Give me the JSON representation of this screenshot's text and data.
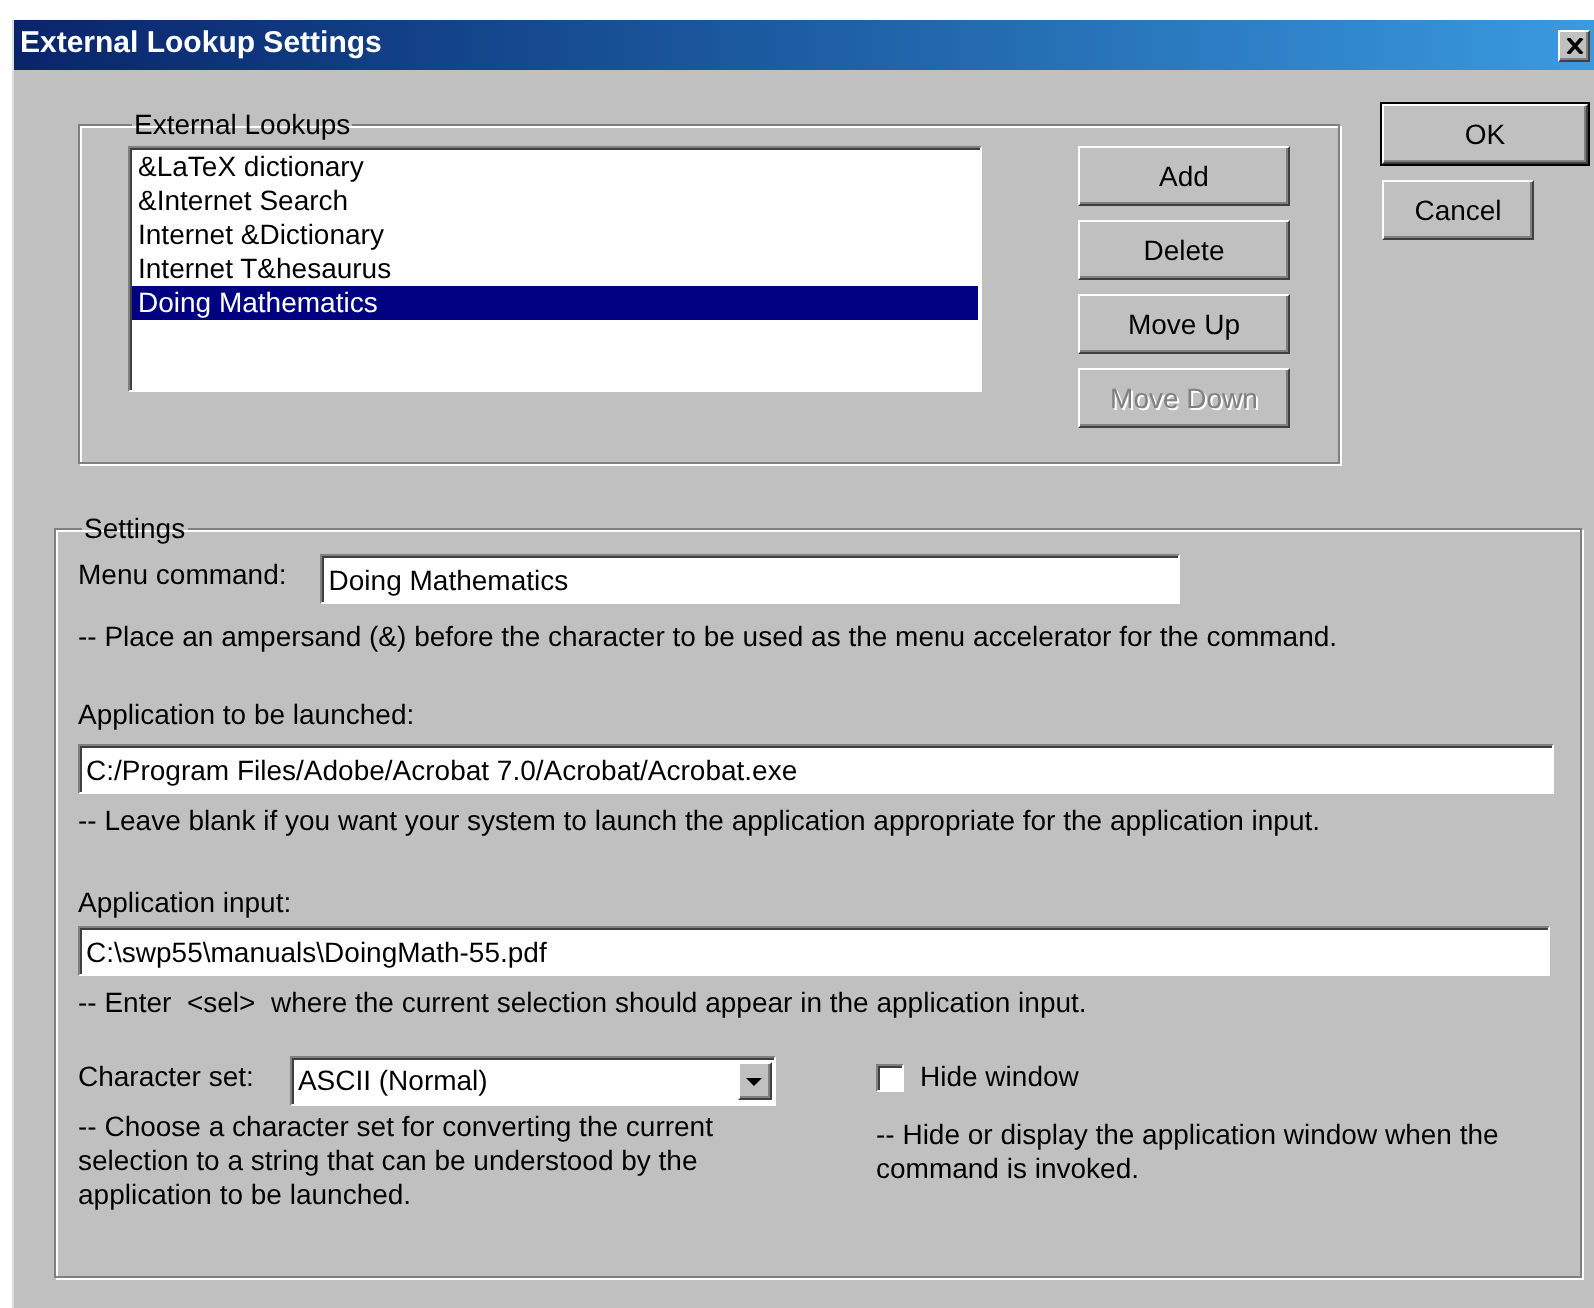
{
  "window": {
    "title": "External Lookup Settings"
  },
  "lookups": {
    "legend": "External Lookups",
    "items": [
      {
        "label": "&LaTeX dictionary",
        "selected": false
      },
      {
        "label": "&Internet Search",
        "selected": false
      },
      {
        "label": "Internet &Dictionary",
        "selected": false
      },
      {
        "label": "Internet T&hesaurus",
        "selected": false
      },
      {
        "label": "Doing Mathematics",
        "selected": true
      }
    ],
    "buttons": [
      {
        "label": "Add",
        "disabled": false
      },
      {
        "label": "Delete",
        "disabled": false
      },
      {
        "label": "Move Up",
        "disabled": false
      },
      {
        "label": "Move Down",
        "disabled": true
      }
    ]
  },
  "dialog_buttons": [
    {
      "label": "OK",
      "default": true
    },
    {
      "label": "Cancel",
      "default": false
    }
  ],
  "settings": {
    "legend": "Settings",
    "menu_command": {
      "label": "Menu command:",
      "value": "Doing Mathematics",
      "hint": "-- Place an ampersand (&) before the character to be used as the menu accelerator for the command."
    },
    "application": {
      "label": "Application to be launched:",
      "value": "C:/Program Files/Adobe/Acrobat 7.0/Acrobat/Acrobat.exe",
      "hint": "-- Leave blank if you want your system to launch the application appropriate for the application input."
    },
    "input": {
      "label": "Application input:",
      "value": "C:\\swp55\\manuals\\DoingMath-55.pdf",
      "hint": "-- Enter  <sel>  where the current selection should appear in the application input."
    },
    "character_set": {
      "label": "Character set:",
      "value": "ASCII (Normal)",
      "hint": "-- Choose a character set for converting the current selection to a string that can be understood by the application to be launched."
    },
    "hide_window": {
      "label": "Hide window",
      "checked": false,
      "hint": "-- Hide or display the application window when the command is invoked."
    }
  }
}
